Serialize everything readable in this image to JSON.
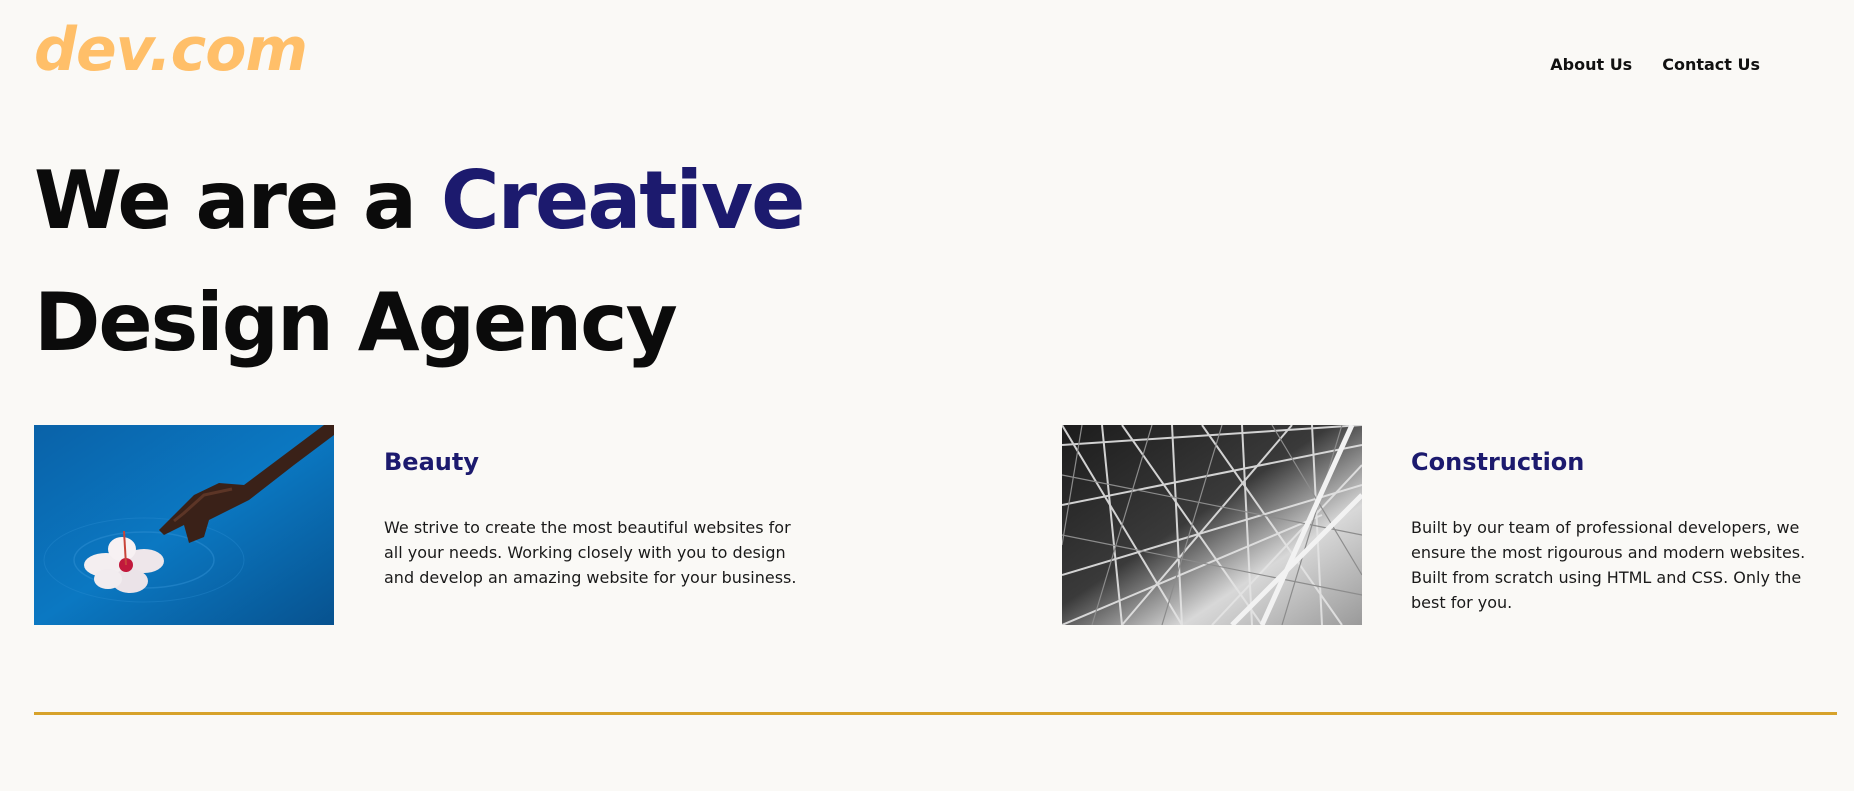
{
  "header": {
    "logo": "dev.com",
    "nav": [
      {
        "label": "About Us"
      },
      {
        "label": "Contact Us"
      }
    ]
  },
  "hero": {
    "line1_plain": "We are a ",
    "line1_accent": "Creative",
    "line2": "Design Agency"
  },
  "cards": [
    {
      "title": "Beauty",
      "text": "We strive to create the most beautiful websites for all your needs. Working closely with you to design and develop an amazing website for your business."
    },
    {
      "title": "Construction",
      "text": "Built by our team of professional developers, we ensure the most rigourous and modern websites. Built from scratch using HTML and CSS. Only the best for you."
    }
  ],
  "colors": {
    "background": "#faf9f6",
    "logo": "#ffbf69",
    "accent": "#1c1a6e",
    "divider": "#d7a22a"
  }
}
